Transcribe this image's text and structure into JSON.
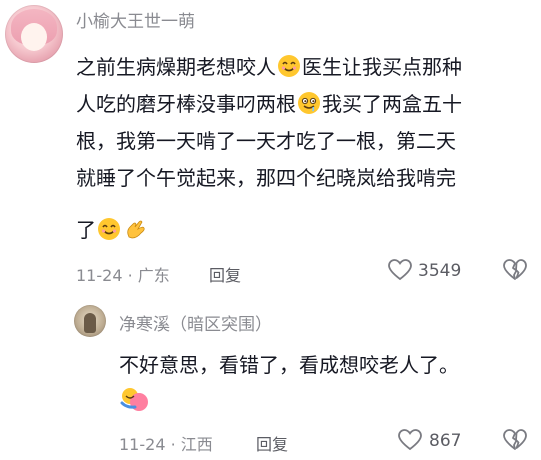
{
  "comment1": {
    "username": "小榆大王世一萌",
    "lines": [
      [
        "之前生病燥期老想咬人",
        "医生让我买点那种"
      ],
      [
        "人吃的磨牙棒没事叼两根",
        "我买了两盒五十"
      ],
      [
        "根，我第一天啃了一天才吃了一根，第二天"
      ],
      [
        "就睡了个午觉起来，那四个纪晓岚给我啃完"
      ],
      [
        "了"
      ]
    ],
    "emojis": [
      "smile-emoji",
      "drool-emoji",
      "smile-emoji",
      "ok-hand-emoji"
    ],
    "date": "11-24",
    "location": "广东",
    "reply_label": "回复",
    "like_count": "3549"
  },
  "comment2": {
    "username": "净寒溪（暗区突围）",
    "text": "不好意思，看错了，看成想咬老人了。",
    "emojis": [
      "hug-emoji"
    ],
    "date": "11-24",
    "location": "江西",
    "reply_label": "回复",
    "like_count": "867"
  },
  "separator": "·"
}
